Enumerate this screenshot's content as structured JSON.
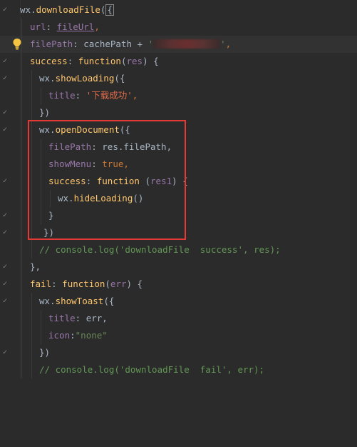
{
  "editor": {
    "theme_colors": {
      "background": "#2b2b2b",
      "current_line": "#323232",
      "keyword": "#cc7832",
      "function": "#ffc66d",
      "property": "#9876aa",
      "string": "#6a8759",
      "comment": "#629755",
      "default_text": "#a9b7c6",
      "highlight_box": "#e53935"
    },
    "lines": [
      {
        "tokens": {
          "t1": "wx.",
          "t2": "downloadFile",
          "t3": "(",
          "t4": "{"
        }
      },
      {
        "tokens": {
          "t1": "url",
          "t2": ": ",
          "t3": "fileUrl",
          "t4": ","
        }
      },
      {
        "tokens": {
          "t1": "filePath",
          "t2": ": cachePath + ",
          "t3": "'",
          "t4": "'",
          "t5": ","
        }
      },
      {
        "tokens": {
          "t1": "success",
          "t2": ": ",
          "t3": "function",
          "t4": "(",
          "t5": "res",
          "t6": ") {"
        }
      },
      {
        "tokens": {
          "t1": "wx.",
          "t2": "showLoading",
          "t3": "({"
        }
      },
      {
        "tokens": {
          "t1": "title",
          "t2": ": ",
          "t3": "'下载成功'",
          "t4": ","
        }
      },
      {
        "tokens": {
          "t1": "})"
        }
      },
      {
        "tokens": {
          "t1": "wx.",
          "t2": "openDocument",
          "t3": "({"
        }
      },
      {
        "tokens": {
          "t1": "filePath",
          "t2": ": res.filePath,",
          "t3": ""
        }
      },
      {
        "tokens": {
          "t1": "showMenu",
          "t2": ": ",
          "t3": "true",
          "t4": ","
        }
      },
      {
        "tokens": {
          "t1": "success",
          "t2": ": ",
          "t3": "function",
          "t4": " (",
          "t5": "res1",
          "t6": ") {"
        }
      },
      {
        "tokens": {
          "t1": "wx.",
          "t2": "hideLoading",
          "t3": "()"
        }
      },
      {
        "tokens": {
          "t1": "}"
        }
      },
      {
        "tokens": {
          "t1": "})"
        }
      },
      {
        "tokens": {
          "t1": "// console.log('downloadFile  success', res);"
        }
      },
      {
        "tokens": {
          "t1": "},"
        }
      },
      {
        "tokens": {
          "t1": "fail",
          "t2": ": ",
          "t3": "function",
          "t4": "(",
          "t5": "err",
          "t6": ") {"
        }
      },
      {
        "tokens": {
          "t1": "wx.",
          "t2": "showToast",
          "t3": "({"
        }
      },
      {
        "tokens": {
          "t1": "title",
          "t2": ": err,",
          "t3": ""
        }
      },
      {
        "tokens": {
          "t1": "icon",
          "t2": ":",
          "t3": "\"none\""
        }
      },
      {
        "tokens": {
          "t1": "})"
        }
      },
      {
        "tokens": {
          "t1": "// console.log('downloadFile  fail', err);"
        }
      }
    ]
  }
}
